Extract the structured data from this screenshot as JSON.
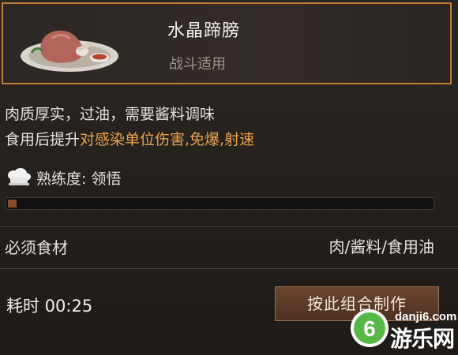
{
  "item": {
    "name": "水晶蹄膀",
    "subtitle": "战斗适用",
    "icon": "pork-knuckle-dish"
  },
  "description": {
    "line1": "肉质厚实，过油，需要酱料调味",
    "line2_prefix": "食用后提升",
    "line2_highlight": "对感染单位伤害,免爆,射速"
  },
  "proficiency": {
    "icon": "chef-hat-icon",
    "label": "熟练度: 领悟",
    "progress_fraction": 0.02
  },
  "ingredients": {
    "label": "必须食材",
    "value": "肉/酱料/食用油"
  },
  "craft": {
    "time_label": "耗时 00:25",
    "button_label": "按此组合制作"
  },
  "watermark": {
    "url": "danji6.com",
    "name": "游乐网",
    "badge": "6"
  },
  "colors": {
    "accent_border": "#c07a36",
    "highlight_text": "#e8a14d",
    "progress_fill": "#8a4c2a"
  }
}
